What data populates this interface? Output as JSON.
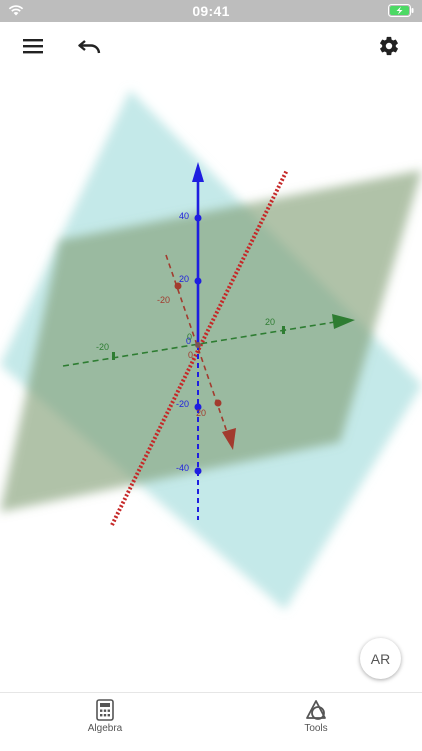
{
  "status_bar": {
    "time": "09:41",
    "icons": [
      "wifi-icon",
      "battery-charging-icon"
    ]
  },
  "toolbar": {
    "icons": [
      "menu-icon",
      "undo-icon",
      "gear-icon"
    ]
  },
  "graphics": {
    "axis_labels": {
      "z_pos_40": "40",
      "z_pos_20": "20",
      "z_zero": "0",
      "z_neg_20": "-20",
      "z_neg_40": "-40",
      "x_neg_20": "-20",
      "x_zero": "0",
      "x_pos_20": "20",
      "y_neg_20": "-20",
      "y_pos_20": "20",
      "y_zero": "0"
    },
    "colors": {
      "z_axis": "#1e1ee0",
      "y_axis": "#2e7d32",
      "x_axis": "#a23b2e",
      "line": "#c62828",
      "plane_1": "#b5e3e3",
      "plane_2": "#7f9c72"
    }
  },
  "ar_button": {
    "label": "AR"
  },
  "bottom_nav": {
    "items": [
      {
        "label": "Algebra",
        "icon": "calculator-icon"
      },
      {
        "label": "Tools",
        "icon": "tools-icon"
      }
    ]
  }
}
